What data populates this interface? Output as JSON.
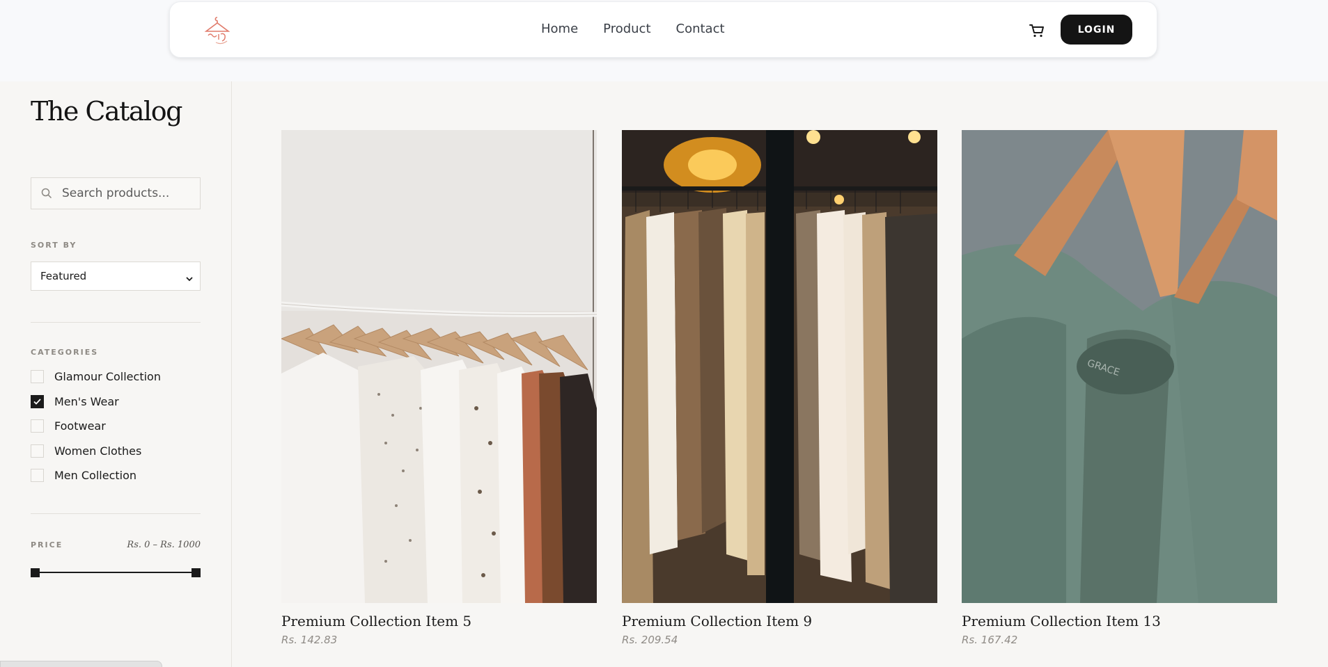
{
  "nav": {
    "links": [
      "Home",
      "Product",
      "Contact"
    ],
    "login_label": "LOGIN"
  },
  "sidebar": {
    "title": "The Catalog",
    "search_placeholder": "Search products...",
    "sort_label": "SORT BY",
    "sort_value": "Featured",
    "categories_label": "CATEGORIES",
    "categories": [
      {
        "label": "Glamour Collection",
        "checked": false
      },
      {
        "label": "Men's Wear",
        "checked": true
      },
      {
        "label": "Footwear",
        "checked": false
      },
      {
        "label": "Women Clothes",
        "checked": false
      },
      {
        "label": "Men Collection",
        "checked": false
      }
    ],
    "price_label": "PRICE",
    "price_range": "Rs. 0 – Rs. 1000"
  },
  "products": [
    {
      "name": "Premium Collection Item 5",
      "price": "Rs. 142.83"
    },
    {
      "name": "Premium Collection Item 9",
      "price": "Rs. 209.54"
    },
    {
      "name": "Premium Collection Item 13",
      "price": "Rs. 167.42"
    }
  ],
  "colors": {
    "accent": "#141414",
    "background": "#f7f6f4",
    "logo": "#e07a6a"
  }
}
